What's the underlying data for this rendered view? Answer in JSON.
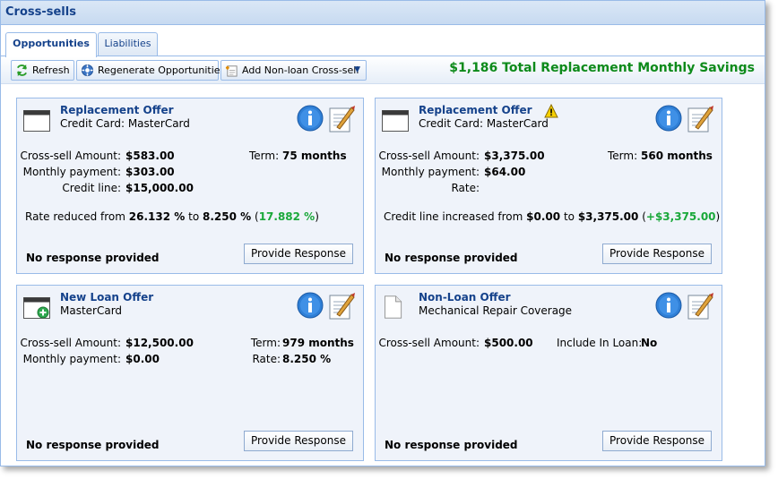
{
  "window": {
    "title": "Cross-sells"
  },
  "tabs": [
    {
      "label": "Opportunities",
      "active": true
    },
    {
      "label": "Liabilities",
      "active": false
    }
  ],
  "toolbar": {
    "refresh_label": "Refresh",
    "regenerate_label": "Regenerate Opportunities",
    "add_label": "Add Non-loan Cross-sell",
    "savings_text": "$1,186 Total Replacement Monthly Savings"
  },
  "cards": [
    {
      "title": "Replacement Offer",
      "subtitle": "Credit Card: MasterCard",
      "cross_sell_label": "Cross-sell Amount:",
      "cross_sell_value": "$583.00",
      "monthly_label": "Monthly payment:",
      "monthly_value": "$303.00",
      "credit_label": "Credit line:",
      "credit_value": "$15,000.00",
      "term_label": "Term:",
      "term_value": "75 months",
      "summary_prefix": "Rate reduced from",
      "summary_from": "26.132 %",
      "summary_mid": "to",
      "summary_to": "8.250 %",
      "summary_open": "(",
      "summary_delta": "17.882 %",
      "summary_close": ")",
      "response": "No response provided",
      "button": "Provide Response"
    },
    {
      "title": "Replacement Offer",
      "subtitle": "Credit Card: MasterCard",
      "cross_sell_label": "Cross-sell Amount:",
      "cross_sell_value": "$3,375.00",
      "monthly_label": "Monthly payment:",
      "monthly_value": "$64.00",
      "rate_label": "Rate:",
      "term_label": "Term:",
      "term_value": "560 months",
      "summary_prefix": "Credit line increased from",
      "summary_from": "$0.00",
      "summary_mid": "to",
      "summary_to": "$3,375.00",
      "summary_open": "(",
      "summary_delta": "+$3,375.00",
      "summary_close": ")",
      "response": "No response provided",
      "button": "Provide Response"
    },
    {
      "title": "New Loan Offer",
      "subtitle": "MasterCard",
      "cross_sell_label": "Cross-sell Amount:",
      "cross_sell_value": "$12,500.00",
      "monthly_label": "Monthly payment:",
      "monthly_value": "$0.00",
      "term_label": "Term:",
      "term_value": "979 months",
      "rate_label": "Rate:",
      "rate_value": "8.250 %",
      "response": "No response provided",
      "button": "Provide Response"
    },
    {
      "title": "Non-Loan Offer",
      "subtitle": "Mechanical Repair Coverage",
      "cross_sell_label": "Cross-sell Amount:",
      "cross_sell_value": "$500.00",
      "include_label": "Include In Loan:",
      "include_value": "No",
      "response": "No response provided",
      "button": "Provide Response"
    }
  ],
  "icons": {
    "card_icon": "credit-card-window-icon",
    "new_loan_icon": "new-loan-window-icon",
    "document_icon": "document-icon",
    "info_icon": "info-icon",
    "edit_icon": "edit-note-icon",
    "warning_icon": "warning-icon",
    "refresh_icon": "refresh-icon",
    "regenerate_icon": "regenerate-icon",
    "add_icon": "add-cross-sell-icon"
  },
  "colors": {
    "accent": "#15428b",
    "savings": "#0d8a1a",
    "positive": "#1aa83a",
    "border": "#99bbe8"
  }
}
